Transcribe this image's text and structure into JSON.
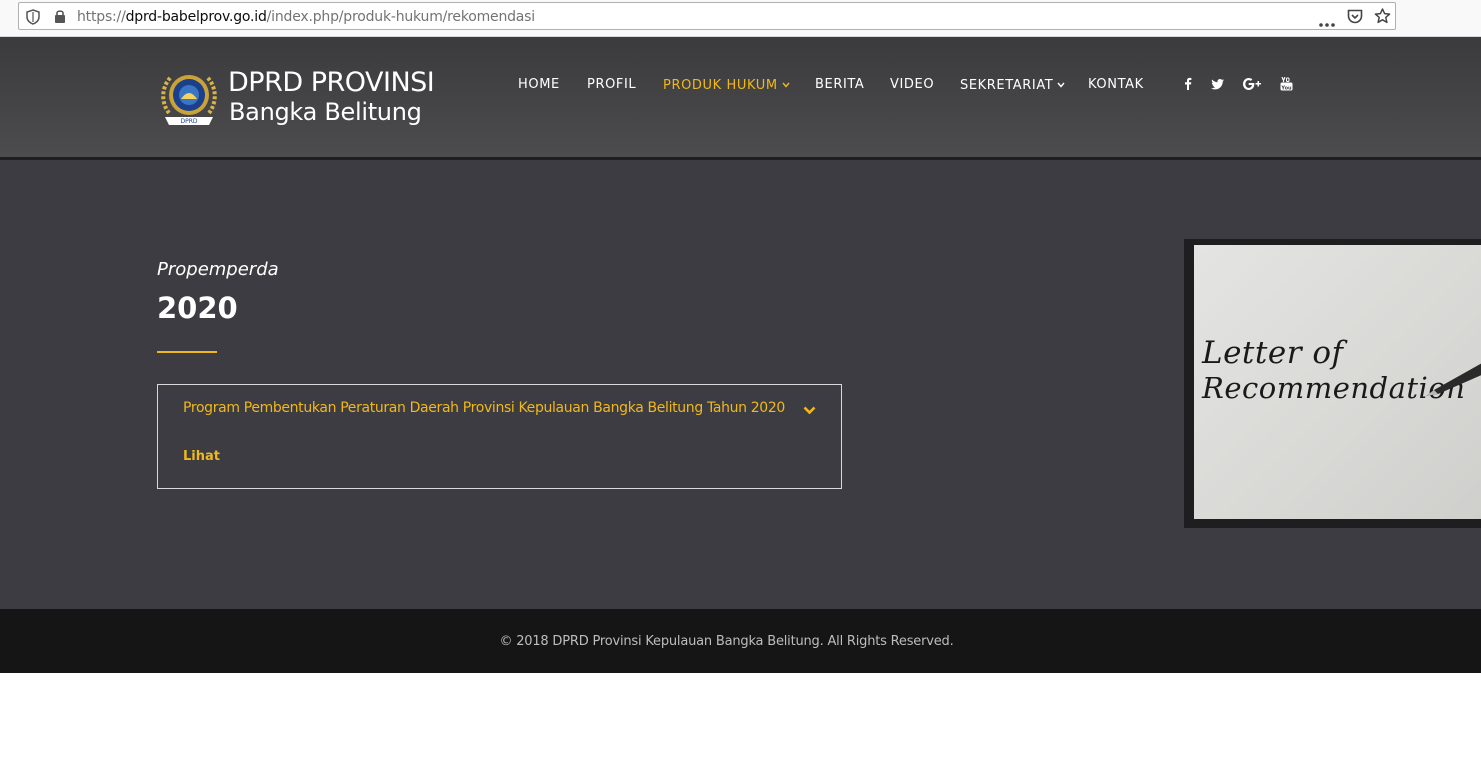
{
  "browser": {
    "url_prefix": "https://",
    "url_domain": "dprd-babelprov.go.id",
    "url_path": "/index.php/produk-hukum/rekomendasi",
    "icons": [
      "shield-icon",
      "lock-icon",
      "more-icon",
      "pocket-icon",
      "star-icon"
    ]
  },
  "header": {
    "logo_line1": "DPRD PROVINSI",
    "logo_line2": "Bangka Belitung",
    "nav": [
      {
        "label": "HOME"
      },
      {
        "label": "PROFIL"
      },
      {
        "label": "PRODUK HUKUM",
        "active": true,
        "dropdown": true
      },
      {
        "label": "BERITA"
      },
      {
        "label": "VIDEO"
      },
      {
        "label": "SEKRETARIAT",
        "dropdown": true
      },
      {
        "label": "KONTAK"
      }
    ],
    "social": [
      "facebook-icon",
      "twitter-icon",
      "google-plus-icon",
      "youtube-icon"
    ],
    "social_glyphs": [
      "f",
      "",
      "G+",
      ""
    ]
  },
  "main": {
    "subtitle": "Propemperda",
    "year": "2020",
    "card": {
      "title": "Program Pembentukan Peraturan Daerah Provinsi Kepulauan Bangka Belitung Tahun 2020",
      "link": "Lihat"
    },
    "image_text_line1": "Letter of",
    "image_text_line2": "Recommendation"
  },
  "footer": {
    "copyright": "© 2018 DPRD Provinsi Kepulauan Bangka Belitung. All Rights Reserved."
  },
  "colors": {
    "accent": "#f0b81a",
    "header_bg": "#444446",
    "main_bg": "#3c3c42",
    "footer_bg": "#151515"
  }
}
